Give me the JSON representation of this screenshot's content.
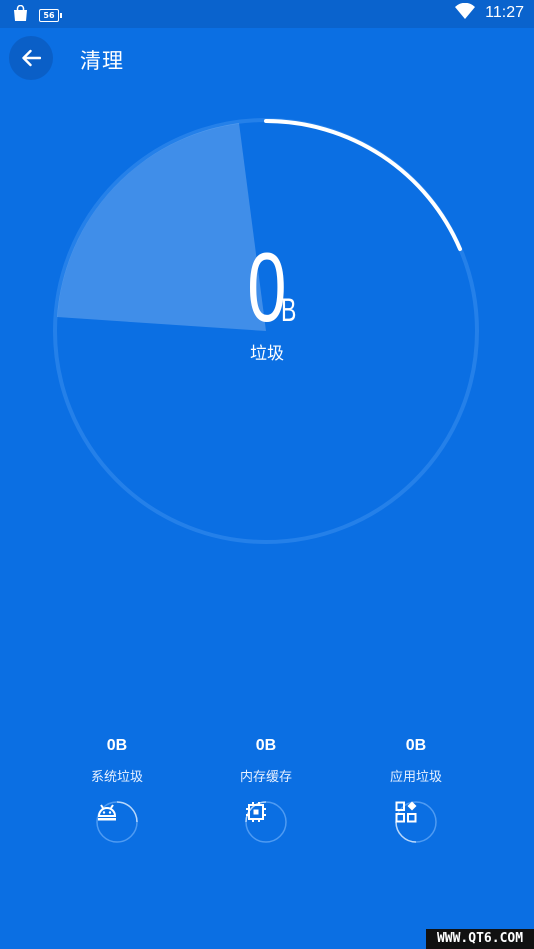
{
  "status_bar": {
    "battery_label": "56",
    "time": "11:27",
    "icons": [
      "shopping-bag-icon",
      "battery-icon",
      "wifi-icon"
    ]
  },
  "app_bar": {
    "back_icon": "arrow-left-icon",
    "title": "清理"
  },
  "gauge": {
    "value": "0",
    "unit": "B",
    "label": "垃圾",
    "scan_progress_arc": "white",
    "accent": "#ffffff",
    "background": "#0b6fe3"
  },
  "categories": [
    {
      "value": "0B",
      "name": "系统垃圾",
      "icon": "android-icon"
    },
    {
      "value": "0B",
      "name": "内存缓存",
      "icon": "cpu-chip-icon"
    },
    {
      "value": "0B",
      "name": "应用垃圾",
      "icon": "apps-grid-icon"
    }
  ],
  "watermark": "WWW.QT6.COM"
}
